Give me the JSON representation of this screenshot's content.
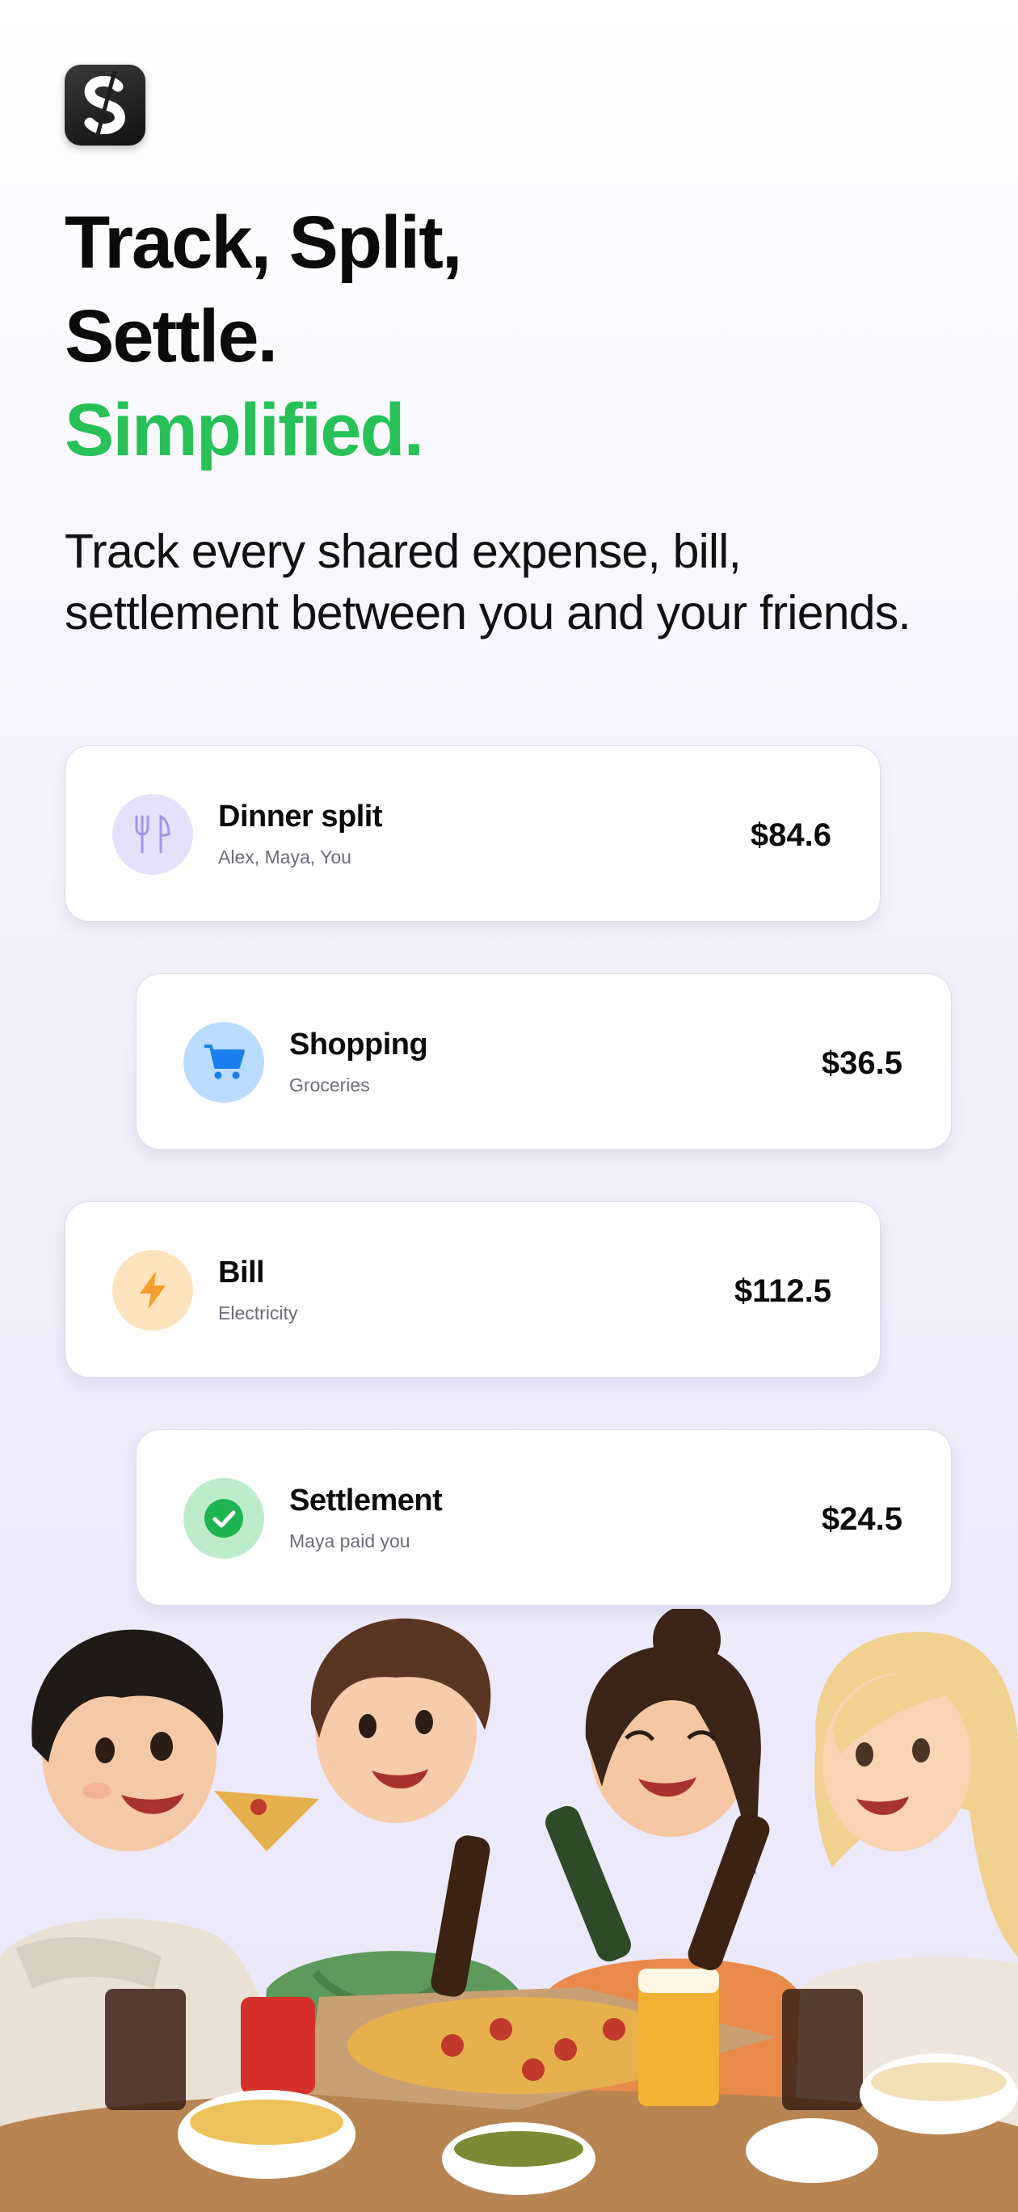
{
  "app": {
    "logo_letter": "S"
  },
  "hero": {
    "line1": "Track, Split,",
    "line2": "Settle.",
    "line3": "Simplified.",
    "accent_color": "#27c157"
  },
  "subtitle": {
    "line1": "Track every shared expense, bill,",
    "line2": "settlement between you and your friends."
  },
  "cards": [
    {
      "title": "Dinner split",
      "subtitle": "Alex, Maya, You",
      "amount": "$84.6",
      "icon": "fork-knife-icon",
      "icon_bg": "#e6e1fb",
      "icon_color": "#a394e8"
    },
    {
      "title": "Shopping",
      "subtitle": "Groceries",
      "amount": "$36.5",
      "icon": "shopping-cart-icon",
      "icon_bg": "#b9dcff",
      "icon_color": "#1b7ff0"
    },
    {
      "title": "Bill",
      "subtitle": "Electricity",
      "amount": "$112.5",
      "icon": "lightning-bolt-icon",
      "icon_bg": "#ffe3bd",
      "icon_color": "#f59e2b"
    },
    {
      "title": "Settlement",
      "subtitle": "Maya paid you",
      "amount": "$24.5",
      "icon": "check-circle-icon",
      "icon_bg": "#bdeccb",
      "icon_color": "#1fb552"
    }
  ]
}
